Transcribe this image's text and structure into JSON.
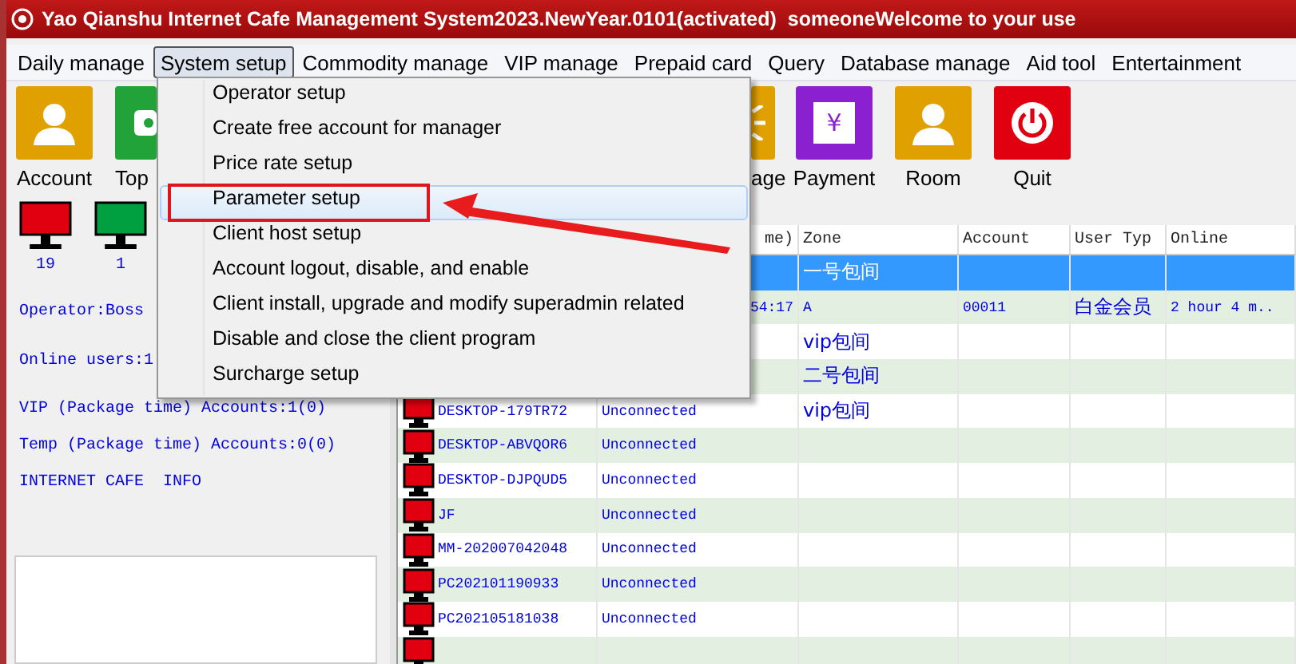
{
  "window": {
    "title": "Yao Qianshu Internet Cafe Management System2023.NewYear.0101(activated)  someoneWelcome to your use"
  },
  "menubar": [
    {
      "label": "Daily manage",
      "selected": false
    },
    {
      "label": "System setup",
      "selected": true
    },
    {
      "label": "Commodity manage",
      "selected": false
    },
    {
      "label": "VIP manage",
      "selected": false
    },
    {
      "label": "Prepaid card",
      "selected": false
    },
    {
      "label": "Query",
      "selected": false
    },
    {
      "label": "Database manage",
      "selected": false
    },
    {
      "label": "Aid tool",
      "selected": false
    },
    {
      "label": "Entertainment",
      "selected": false
    }
  ],
  "toolbar": [
    {
      "label": "Account",
      "kind": "person",
      "color": "#e0a000",
      "partial": false
    },
    {
      "label": "Top",
      "kind": "cash",
      "color": "#22a33a",
      "partial": true
    },
    {
      "label": "age",
      "kind": "burst",
      "color": "#e0a000",
      "partial": true
    },
    {
      "label": "Payment",
      "kind": "yen",
      "glyph": "¥",
      "color": "#8a20d0",
      "partial": false
    },
    {
      "label": "Room",
      "kind": "person",
      "color": "#e0a000",
      "partial": false
    },
    {
      "label": "Quit",
      "kind": "power",
      "color": "#e00010",
      "partial": false
    }
  ],
  "status_panel": {
    "monitors": [
      {
        "count": "19",
        "color": "#e00010"
      },
      {
        "count": "1",
        "color": "#00a040"
      }
    ],
    "lines": [
      "Operator:Boss",
      "Online users:1",
      "VIP (Package time) Accounts:1(0)",
      "Temp (Package time) Accounts:0(0)",
      "INTERNET CAFE  INFO"
    ]
  },
  "table": {
    "columns": [
      "me)",
      "Zone",
      "Account",
      "User Typ",
      "Online"
    ],
    "rows": [
      {
        "zone": "一号包间",
        "selected": true
      },
      {
        "status": "54:17",
        "zone": "A",
        "account": "00011",
        "user_type": "白金会员",
        "online": "2 hour 4 m..",
        "selected": false
      },
      {
        "zone": "vip包间",
        "selected": false
      },
      {
        "zone": "二号包间",
        "selected": false
      },
      {
        "host": "DESKTOP-179TR72",
        "status": "Unconnected",
        "zone": "vip包间",
        "selected": false
      },
      {
        "host": "DESKTOP-ABVQOR6",
        "status": "Unconnected",
        "selected": false
      },
      {
        "host": "DESKTOP-DJPQUD5",
        "status": "Unconnected",
        "selected": false
      },
      {
        "host": "JF",
        "status": "Unconnected",
        "selected": false
      },
      {
        "host": "MM-202007042048",
        "status": "Unconnected",
        "selected": false
      },
      {
        "host": "PC202101190933",
        "status": "Unconnected",
        "selected": false
      },
      {
        "host": "PC202105181038",
        "status": "Unconnected",
        "selected": false
      },
      {
        "selected": false
      }
    ]
  },
  "dropdown_menu": {
    "items": [
      {
        "label": "Operator setup",
        "selected": false
      },
      {
        "label": "Create free account for manager",
        "selected": false
      },
      {
        "label": "Price rate setup",
        "selected": false
      },
      {
        "label": "Parameter setup",
        "selected": true
      },
      {
        "label": "Client host setup",
        "selected": false
      },
      {
        "label": "Account logout, disable, and enable",
        "selected": false
      },
      {
        "label": "Client install, upgrade and modify superadmin related",
        "selected": false
      },
      {
        "label": "Disable and close the client program",
        "selected": false
      },
      {
        "label": "Surcharge setup",
        "selected": false
      }
    ]
  }
}
